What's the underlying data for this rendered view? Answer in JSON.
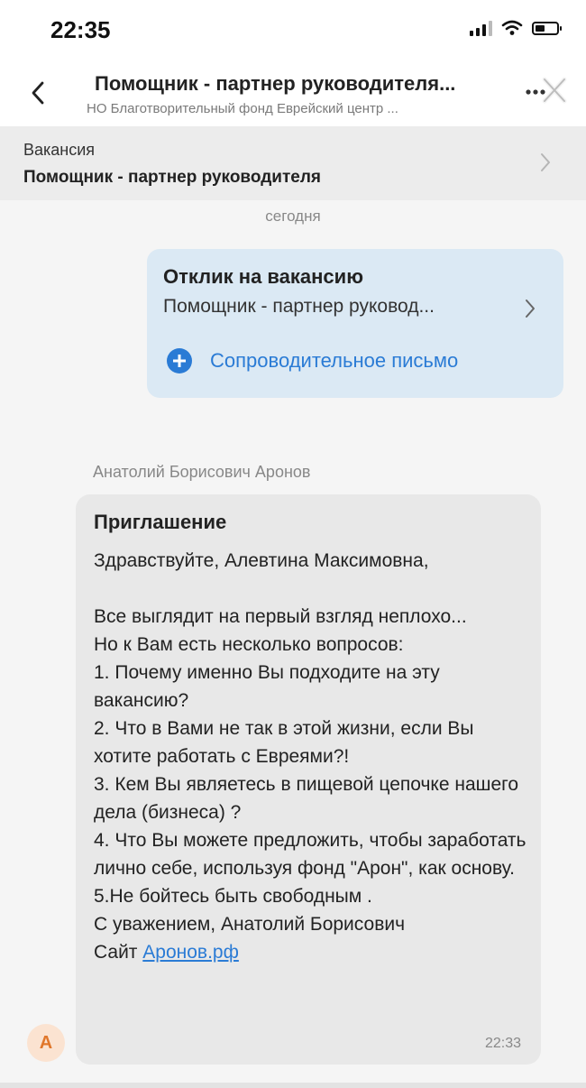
{
  "status_bar": {
    "time": "22:35",
    "battery_level": 0.45,
    "icons": [
      "signal-icon",
      "wifi-icon",
      "battery-icon"
    ]
  },
  "header": {
    "title": "Помощник - партнер руководителя...",
    "subtitle": "НО Благотворительный фонд Еврейский центр ...",
    "back_icon": "chevron-left-icon",
    "more_icon": "more-dots-icon"
  },
  "vacancy": {
    "label": "Вакансия",
    "title": "Помощник - партнер руководителя"
  },
  "date_separator": "сегодня",
  "reply_card": {
    "heading": "Отклик на вакансию",
    "vacancy": "Помощник - партнер руковод...",
    "cover_letter_label": "Сопроводительное письмо"
  },
  "incoming": {
    "sender": "Анатолий Борисович Аронов",
    "avatar_letter": "А",
    "heading": "Приглашение",
    "greeting": "Здравствуйте, Алевтина Максимовна,",
    "lines": [
      "Все выглядит на первый взгляд неплохо...",
      "Но к Вам есть несколько вопросов:",
      "1. Почему именно Вы подходите на эту вакансию?",
      "2. Что в Вами не так в этой жизни, если Вы хотите работать с Евреями?!",
      "3. Кем Вы являетесь в пищевой цепочке нашего дела (бизнеса) ?",
      "4. Что Вы можете предложить, чтобы заработать лично себе, используя фонд \"Арон\", как основу.",
      "5.Не бойтесь быть свободным .",
      "С уважением, Анатолий Борисович"
    ],
    "site_prefix": "Сайт",
    "site_link": "Аронов.рф",
    "time": "22:33"
  },
  "colors": {
    "accent": "#2a7bd5",
    "reply_card_bg": "#dbe9f4",
    "incoming_bg": "#e8e8e8",
    "avatar_bg": "#fbe3d1",
    "avatar_fg": "#e0772b"
  }
}
